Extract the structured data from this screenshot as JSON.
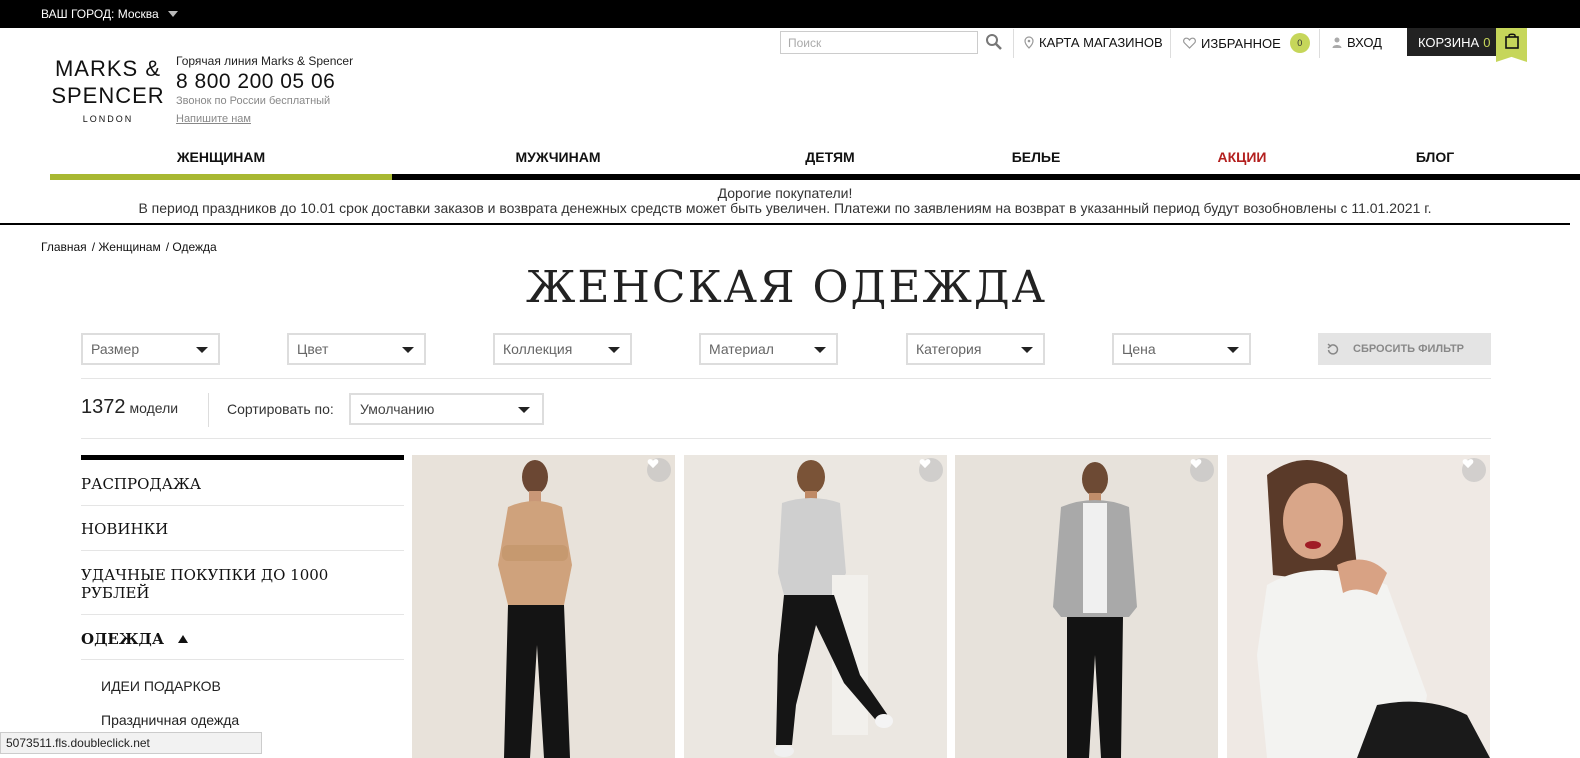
{
  "topbar": {
    "city_label": "ВАШ ГОРОД: Москва"
  },
  "logo": {
    "line1": "MARKS &",
    "line2": "SPENCER",
    "line3": "LONDON"
  },
  "hotline": {
    "title": "Горячая линия Marks & Spencer",
    "phone": "8 800 200 05 06",
    "free": "Звонок по России бесплатный",
    "write": "Напишите нам"
  },
  "search": {
    "placeholder": "Поиск"
  },
  "header": {
    "stores": "КАРТА МАГАЗИНОВ",
    "favorites": "ИЗБРАННОЕ",
    "favorites_count": "0",
    "login": "ВХОД",
    "cart": "КОРЗИНА",
    "cart_count": "0"
  },
  "nav": [
    {
      "label": "ЖЕНЩИНАМ"
    },
    {
      "label": "МУЖЧИНАМ"
    },
    {
      "label": "ДЕТЯМ"
    },
    {
      "label": "БЕЛЬЕ"
    },
    {
      "label": "АКЦИИ"
    },
    {
      "label": "БЛОГ"
    }
  ],
  "notice": {
    "line1": "Дорогие покупатели!",
    "line2": "В период праздников до 10.01 срок доставки заказов и возврата денежных средств может быть увеличен. Платежи по заявлениям на возврат в указанный период будут возобновлены с 11.01.2021 г."
  },
  "breadcrumb": {
    "home": "Главная",
    "women": "/ Женщинам",
    "current": "/ Одежда"
  },
  "page_title": "ЖЕНСКАЯ ОДЕЖДА",
  "filters": [
    {
      "label": "Размер"
    },
    {
      "label": "Цвет"
    },
    {
      "label": "Коллекция"
    },
    {
      "label": "Материал"
    },
    {
      "label": "Категория"
    },
    {
      "label": "Цена"
    }
  ],
  "reset_label": "СБРОСИТЬ ФИЛЬТР",
  "results": {
    "count": "1372",
    "unit": "модели"
  },
  "sort": {
    "label": "Сортировать по:",
    "value": "Умолчанию"
  },
  "sidebar": {
    "items": [
      {
        "label": "РАСПРОДАЖА"
      },
      {
        "label": "НОВИНКИ"
      },
      {
        "label": "УДАЧНЫЕ ПОКУПКИ ДО 1000 РУБЛЕЙ"
      },
      {
        "label": "ОДЕЖДА"
      }
    ],
    "sub": [
      {
        "label": "ИДЕИ ПОДАРКОВ"
      },
      {
        "label": "Праздничная одежда"
      }
    ]
  },
  "status_url": "5073511.fls.doubleclick.net",
  "colors": {
    "accent": "#a8b832",
    "badge": "#c6d65a",
    "sale": "#b3201f"
  }
}
